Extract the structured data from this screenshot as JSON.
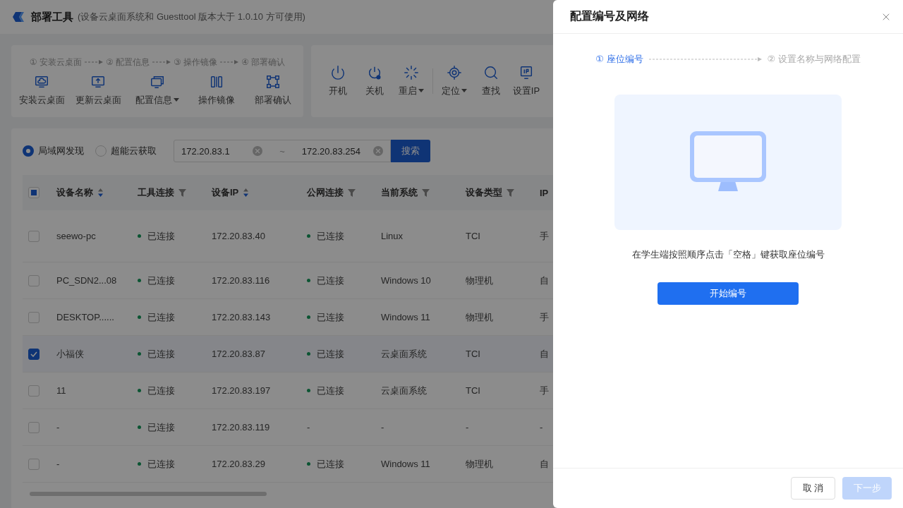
{
  "app": {
    "title": "部署工具",
    "subtitle": "(设备云桌面系统和 Guesttool 版本大于 1.0.10 方可使用)"
  },
  "workflow": {
    "steps": [
      {
        "number": "①",
        "label": "安装云桌面"
      },
      {
        "number": "②",
        "label": "配置信息"
      },
      {
        "number": "③",
        "label": "操作镜像"
      },
      {
        "number": "④",
        "label": "部署确认"
      }
    ],
    "actions": [
      {
        "label": "安装云桌面",
        "dropdown": false
      },
      {
        "label": "更新云桌面",
        "dropdown": false
      },
      {
        "label": "配置信息",
        "dropdown": true
      },
      {
        "label": "操作镜像",
        "dropdown": false
      },
      {
        "label": "部署确认",
        "dropdown": false
      }
    ]
  },
  "device_actions": [
    {
      "label": "开机",
      "dropdown": false
    },
    {
      "label": "关机",
      "dropdown": false
    },
    {
      "label": "重启",
      "dropdown": true
    },
    {
      "label": "定位",
      "dropdown": true
    },
    {
      "label": "查找",
      "dropdown": false
    },
    {
      "label": "设置IP",
      "dropdown": false
    }
  ],
  "discovery": {
    "modes": [
      {
        "label": "局域网发现",
        "selected": true
      },
      {
        "label": "超能云获取",
        "selected": false
      }
    ],
    "ip_from": "172.20.83.1",
    "separator": "~",
    "ip_to": "172.20.83.254",
    "search_button": "搜索"
  },
  "table": {
    "select_all": {
      "indeterminate": true
    },
    "columns": [
      {
        "label": "设备名称",
        "kind": "sort"
      },
      {
        "label": "工具连接",
        "kind": "filter"
      },
      {
        "label": "设备IP",
        "kind": "sort"
      },
      {
        "label": "公网连接",
        "kind": "filter"
      },
      {
        "label": "当前系统",
        "kind": "filter"
      },
      {
        "label": "设备类型",
        "kind": "filter"
      },
      {
        "label": "IP",
        "kind": "plain"
      }
    ],
    "rows": [
      {
        "checked": false,
        "name": "seewo-pc",
        "tool": "已连接",
        "ip": "172.20.83.40",
        "public": "已连接",
        "public_online": true,
        "system": "Linux",
        "type": "TCI",
        "column_7": "手"
      },
      {
        "checked": false,
        "name": "PC_SDN2...08",
        "tool": "已连接",
        "ip": "172.20.83.116",
        "public": "已连接",
        "public_online": true,
        "system": "Windows 10",
        "type": "物理机",
        "column_7": "自"
      },
      {
        "checked": false,
        "name": "DESKTOP......",
        "tool": "已连接",
        "ip": "172.20.83.143",
        "public": "已连接",
        "public_online": true,
        "system": "Windows 11",
        "type": "物理机",
        "column_7": "手"
      },
      {
        "checked": true,
        "name": "小福侠",
        "tool": "已连接",
        "ip": "172.20.83.87",
        "public": "已连接",
        "public_online": true,
        "system": "云桌面系统",
        "type": "TCI",
        "column_7": "自"
      },
      {
        "checked": false,
        "name": "11",
        "tool": "已连接",
        "ip": "172.20.83.197",
        "public": "已连接",
        "public_online": true,
        "system": "云桌面系统",
        "type": "TCI",
        "column_7": "手"
      },
      {
        "checked": false,
        "name": "-",
        "tool": "已连接",
        "ip": "172.20.83.119",
        "public": "-",
        "public_online": false,
        "system": "-",
        "type": "-",
        "column_7": "-"
      },
      {
        "checked": false,
        "name": "-",
        "tool": "已连接",
        "ip": "172.20.83.29",
        "public": "已连接",
        "public_online": true,
        "system": "Windows 11",
        "type": "物理机",
        "column_7": "自"
      }
    ]
  },
  "drawer": {
    "title": "配置编号及网络",
    "steps": [
      {
        "number": "①",
        "label": "座位编号",
        "selected": true
      },
      {
        "number": "②",
        "label": "设置名称与网络配置",
        "selected": false
      }
    ],
    "instruction": "在学生端按照顺序点击「空格」键获取座位编号",
    "start_button": "开始编号",
    "cancel_button": "取 消",
    "next_button": {
      "label": "下一步",
      "disabled": true
    }
  }
}
